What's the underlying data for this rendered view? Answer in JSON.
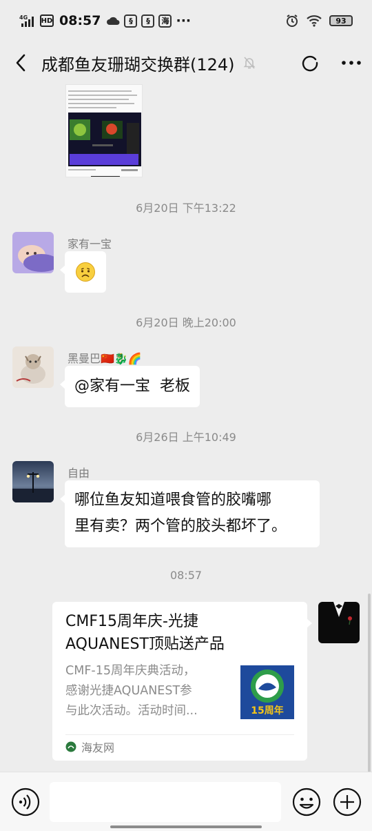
{
  "status_bar": {
    "network": "4G",
    "hd": "HD",
    "time": "08:57",
    "app_badges": [
      "海"
    ],
    "more": "···",
    "battery": "93"
  },
  "header": {
    "title": "成都鱼友珊瑚交换群(124)"
  },
  "messages": [
    {
      "type": "timestamp",
      "text": "6月20日 下午13:22"
    },
    {
      "type": "message",
      "sender": "家有一宝",
      "content": "🙁"
    },
    {
      "type": "timestamp",
      "text": "6月20日 晚上20:00"
    },
    {
      "type": "message",
      "sender": "黑曼巴🇨🇳🐉🌈",
      "content": "@家有一宝  老板"
    },
    {
      "type": "timestamp",
      "text": "6月26日 上午10:49"
    },
    {
      "type": "message",
      "sender": "自由",
      "content_lines": [
        "哪位鱼友知道喂食管的胶嘴哪",
        "里有卖？两个管的胶头都坏了。"
      ]
    },
    {
      "type": "timestamp",
      "text": "08:57"
    },
    {
      "type": "link_card",
      "title_lines": [
        "CMF15周年庆-光捷",
        "AQUANEST顶贴送产品"
      ],
      "desc_lines": [
        "CMF-15周年庆典活动，",
        "感谢光捷AQUANEST参",
        "与此次活动。活动时间..."
      ],
      "thumb_text": "15周年",
      "source": "海友网"
    }
  ],
  "input_bar": {
    "placeholder": ""
  },
  "colors": {
    "background": "#ededed",
    "bubble": "#ffffff",
    "timestamp": "#8a8a8a",
    "sender": "#7d7d7d",
    "thumb_blue": "#1e4a9c",
    "thumb_gold": "#f5c518"
  },
  "icons": [
    "back-arrow-icon",
    "mute-bell-icon",
    "refresh-icon",
    "more-icon",
    "voice-icon",
    "emoji-icon",
    "plus-icon",
    "signal-icon",
    "wifi-icon",
    "alarm-icon"
  ]
}
